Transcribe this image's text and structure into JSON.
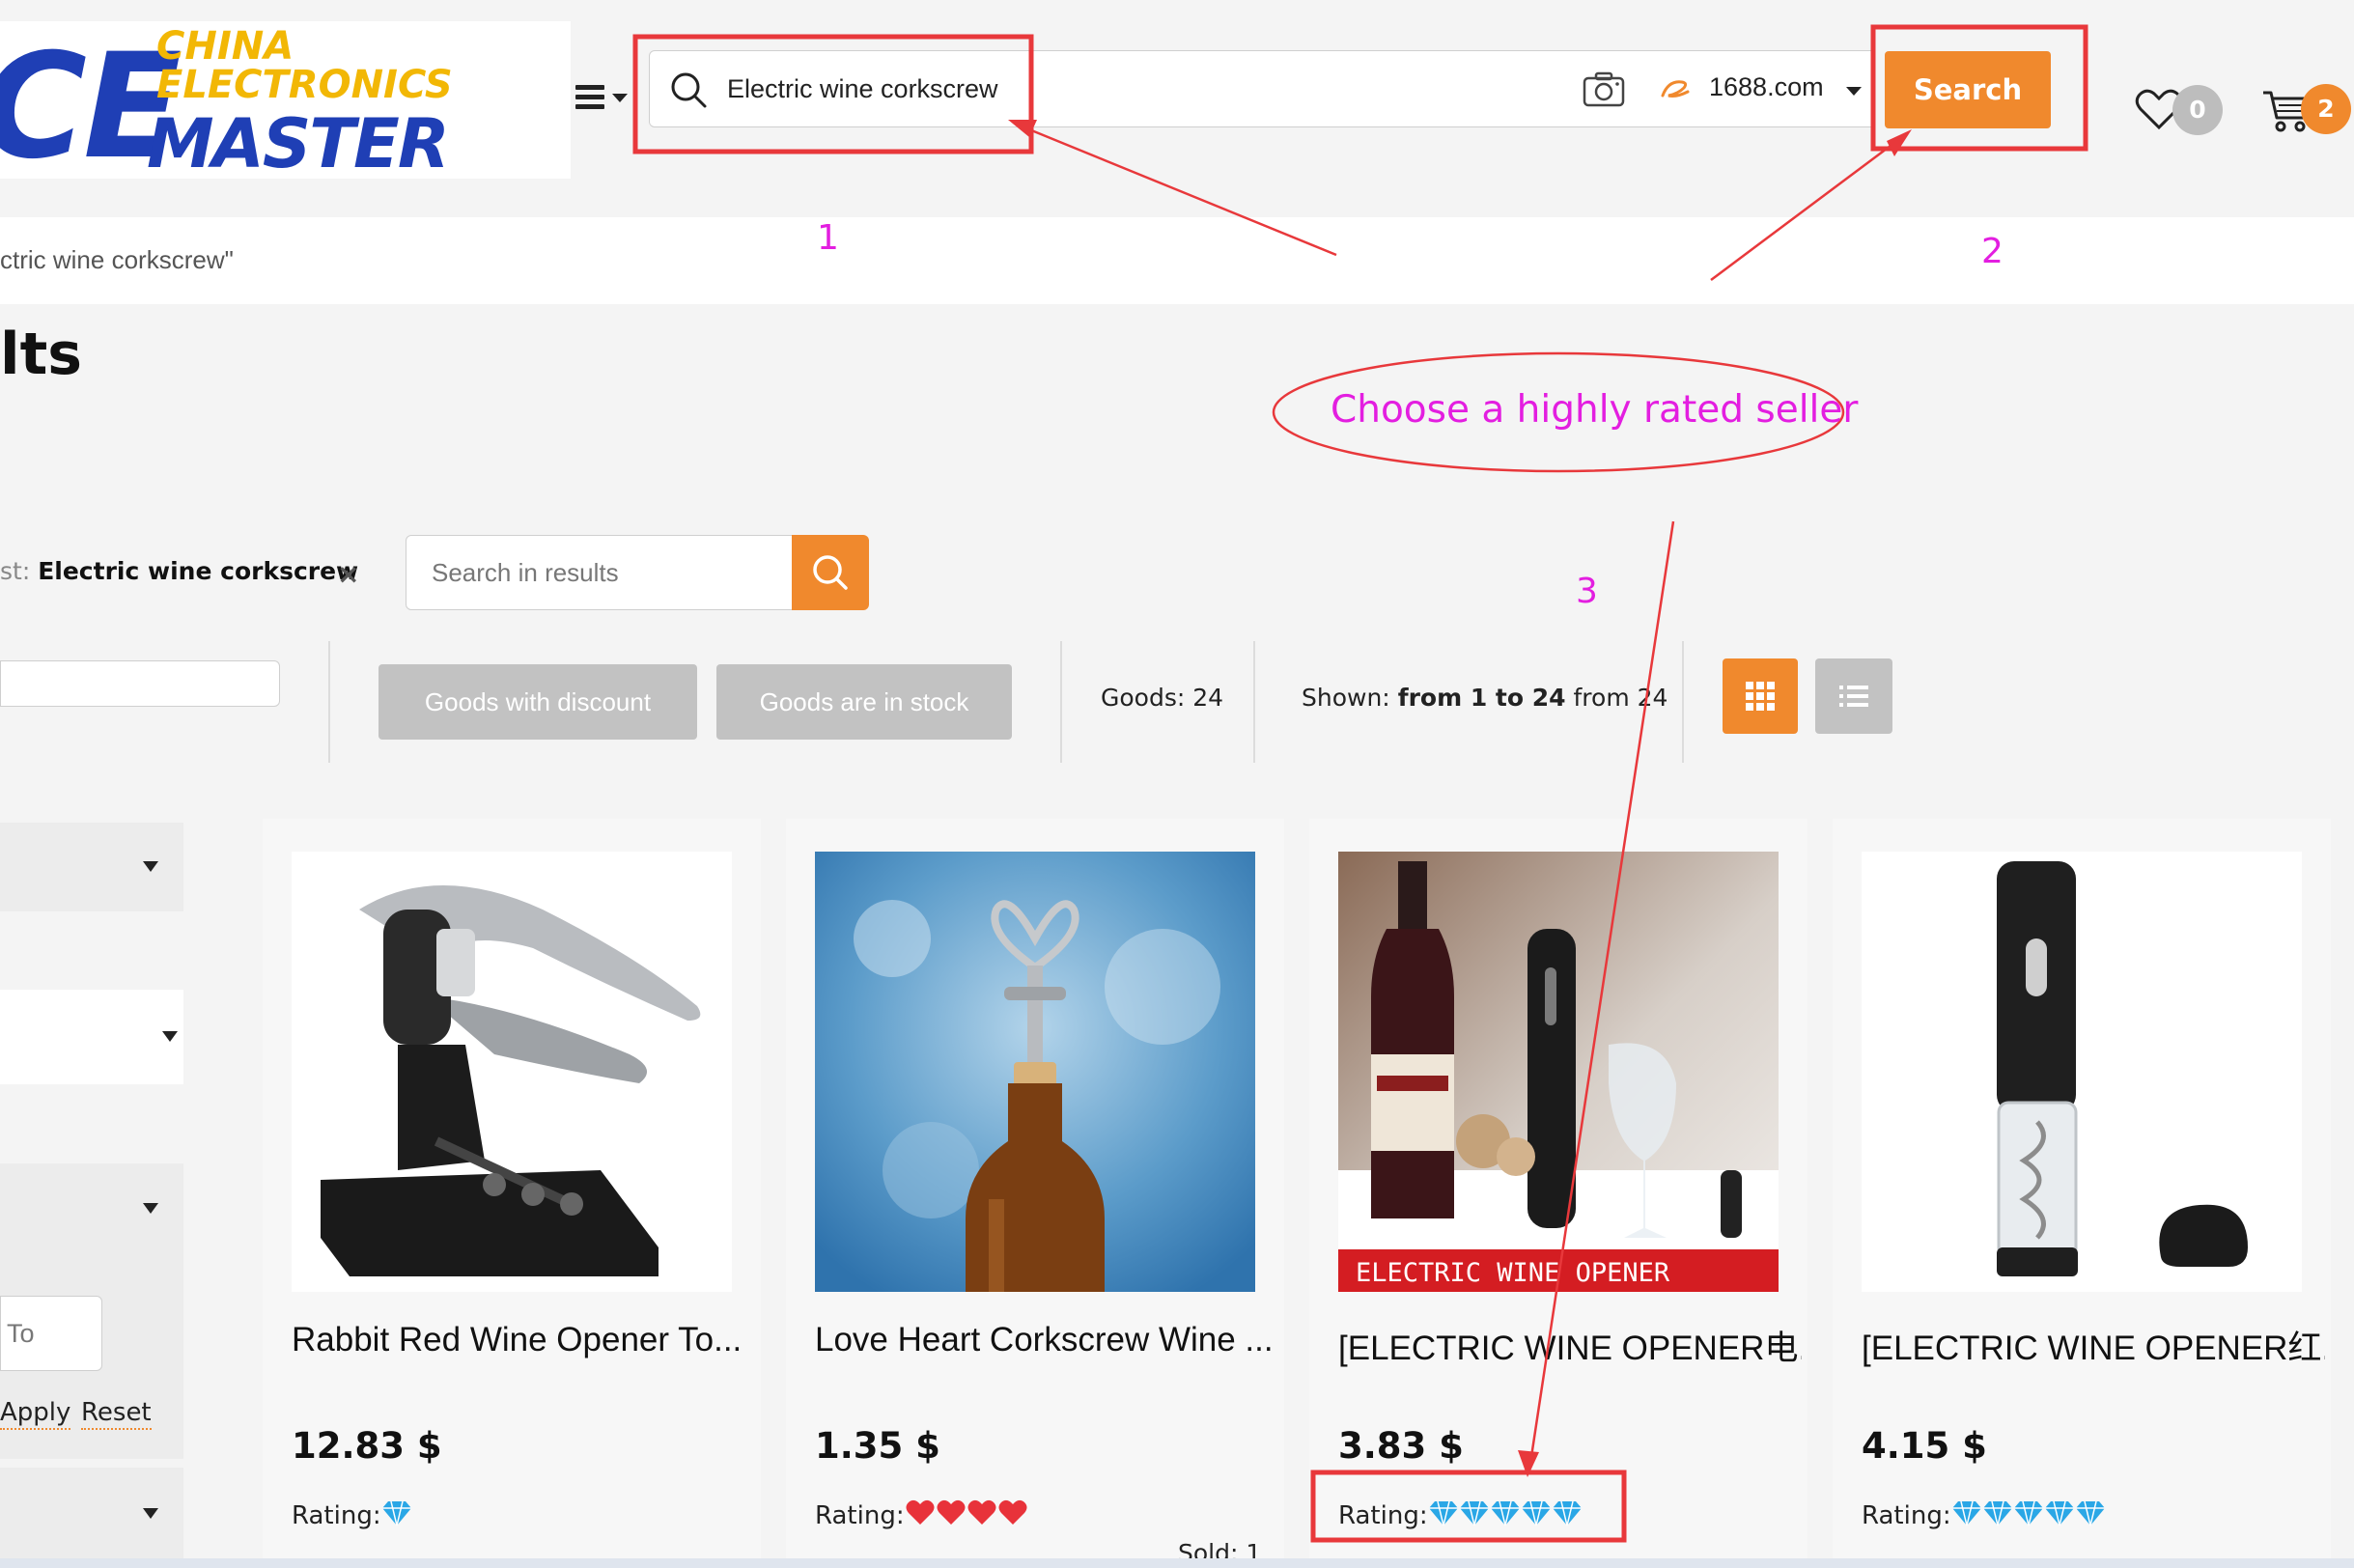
{
  "logo": {
    "mark": "CE",
    "line1": "CHINA",
    "line2": "ELECTRONICS",
    "line3": "MASTER"
  },
  "search": {
    "query": "Electric wine corkscrew",
    "source": "1688.com",
    "button_label": "Search"
  },
  "header": {
    "wishlist_count": "0",
    "cart_count": "2"
  },
  "breadcrumb": "ctric wine corkscrew\"",
  "page_title": "lts",
  "filters": {
    "query_prefix": "st:",
    "query_value": "Electric wine corkscrew",
    "clear_icon": "×",
    "search_in_results_placeholder": "Search in results",
    "chip_discount": "Goods with discount",
    "chip_stock": "Goods are in stock",
    "goods_label": "Goods: 24",
    "shown_label": "Shown:",
    "shown_from": "from 1 to 24",
    "shown_total": "from 24"
  },
  "sidebar": {
    "price_to_placeholder": "To",
    "apply_label": "Apply",
    "reset_label": "Reset"
  },
  "products": [
    {
      "title": "Rabbit Red Wine Opener To...",
      "price": "12.83 $",
      "rating_label": "Rating:",
      "rating_icon": "diamond-icon",
      "rating_count": 1
    },
    {
      "title": "Love Heart Corkscrew Wine ...",
      "price": "1.35 $",
      "rating_label": "Rating:",
      "rating_icon": "heart-icon",
      "rating_count": 4
    },
    {
      "title": "[ELECTRIC WINE OPENER电...",
      "price": "3.83 $",
      "rating_label": "Rating:",
      "rating_icon": "diamond-icon",
      "rating_count": 5,
      "image_banner": "ELECTRIC WINE OPENER"
    },
    {
      "title": "[ELECTRIC WINE OPENER红...",
      "price": "4.15 $",
      "rating_label": "Rating:",
      "rating_icon": "diamond-icon",
      "rating_count": 5
    }
  ],
  "sold_label": "Sold: 1",
  "annotations": {
    "step1": "1",
    "step2": "2",
    "step3": "3",
    "callout": "Choose a highly rated seller",
    "color": "#e31ee0",
    "box_color": "#e8383b"
  },
  "colors": {
    "accent": "#f0892d",
    "brand_blue": "#1f3fb5",
    "brand_yellow": "#f2b705",
    "diamond": "#2aa7e6",
    "heart": "#e8323a"
  }
}
